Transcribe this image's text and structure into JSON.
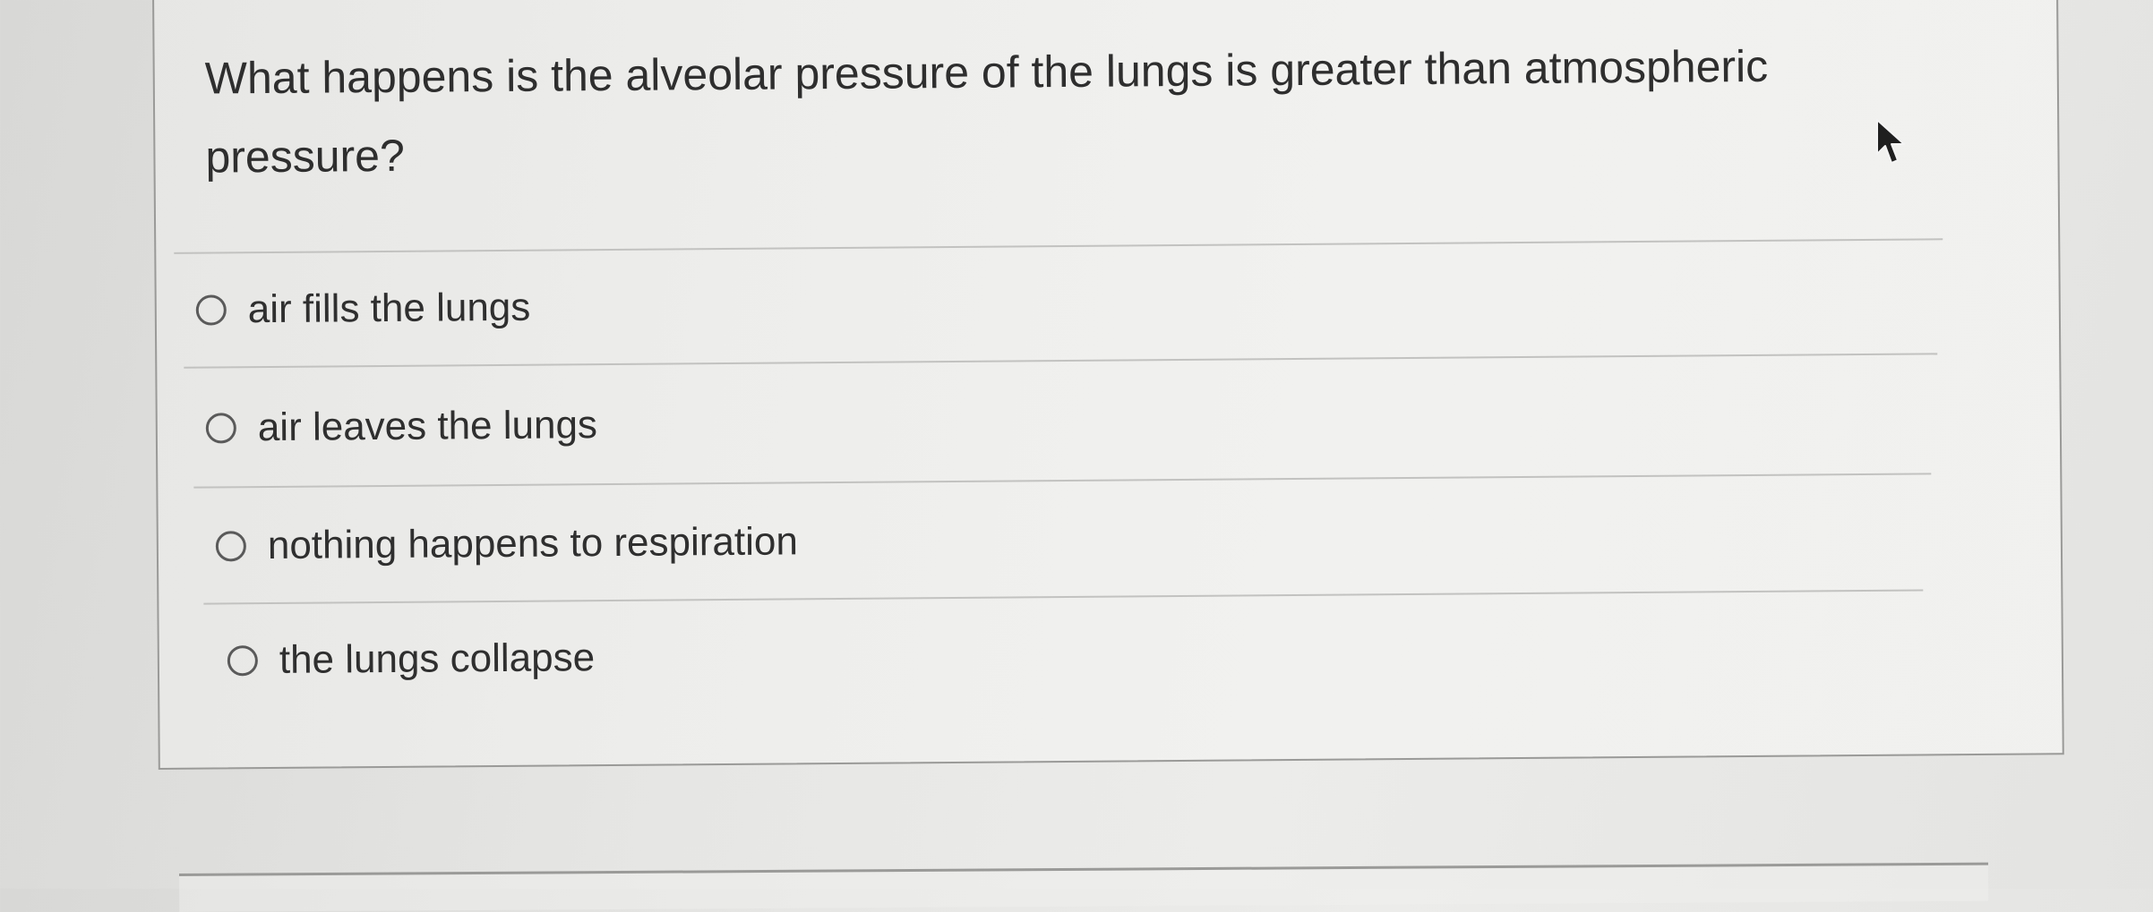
{
  "question": {
    "text": "What happens is the alveolar pressure of the lungs is greater than atmospheric pressure?",
    "options": [
      {
        "label": "air fills the lungs",
        "selected": false
      },
      {
        "label": "air leaves the lungs",
        "selected": false
      },
      {
        "label": "nothing happens to respiration",
        "selected": false
      },
      {
        "label": "the lungs collapse",
        "selected": false
      }
    ]
  },
  "icons": {
    "cursor": "mouse-pointer-icon",
    "radio": "radio-button-icon"
  },
  "colors": {
    "text": "#2f2f2f",
    "border": "#9a9a98",
    "divider": "#c2c2c0",
    "radio_outline": "#5a5a5a"
  }
}
